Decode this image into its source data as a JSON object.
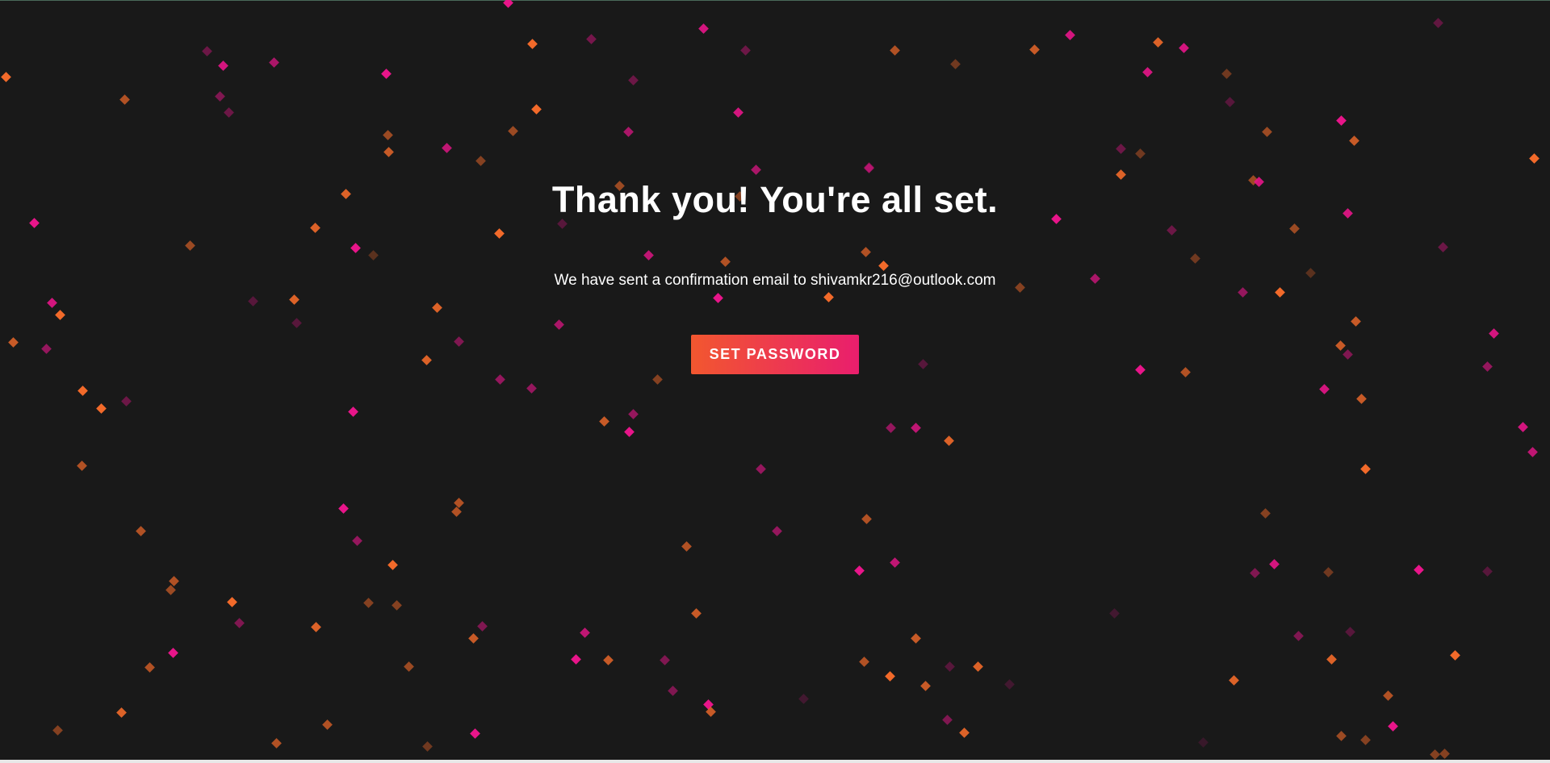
{
  "page": {
    "title": "Thank you! You're all set.",
    "confirmation_message": "We have sent a confirmation email to shivamkr216@outlook.com",
    "set_password_label": "SET PASSWORD"
  },
  "colors": {
    "background": "#191919",
    "button_gradient_start": "#f2572f",
    "button_gradient_end": "#e91e6d",
    "confetti_orange": "#f26a2a",
    "confetti_pink": "#e8158a"
  }
}
